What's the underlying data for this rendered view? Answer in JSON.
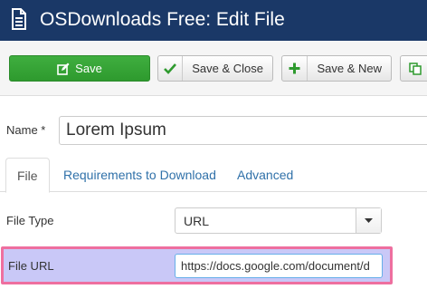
{
  "header": {
    "title": "OSDownloads Free: Edit File",
    "icon": "file-icon"
  },
  "toolbar": {
    "save_label": "Save",
    "save_close_label": "Save & Close",
    "save_new_label": "Save & New",
    "save_color": "#34a434"
  },
  "form": {
    "name_label": "Name *",
    "name_value": "Lorem Ipsum",
    "tabs": [
      {
        "label": "File",
        "active": true
      },
      {
        "label": "Requirements to Download",
        "active": false
      },
      {
        "label": "Advanced",
        "active": false
      }
    ],
    "file_type_label": "File Type",
    "file_type_value": "URL",
    "file_url_label": "File URL",
    "file_url_value": "https://docs.google.com/document/d"
  },
  "colors": {
    "header_bg": "#1a3867",
    "highlight_bg": "#c9c8f7",
    "highlight_border": "#ee6f9f",
    "link": "#3071a9"
  }
}
